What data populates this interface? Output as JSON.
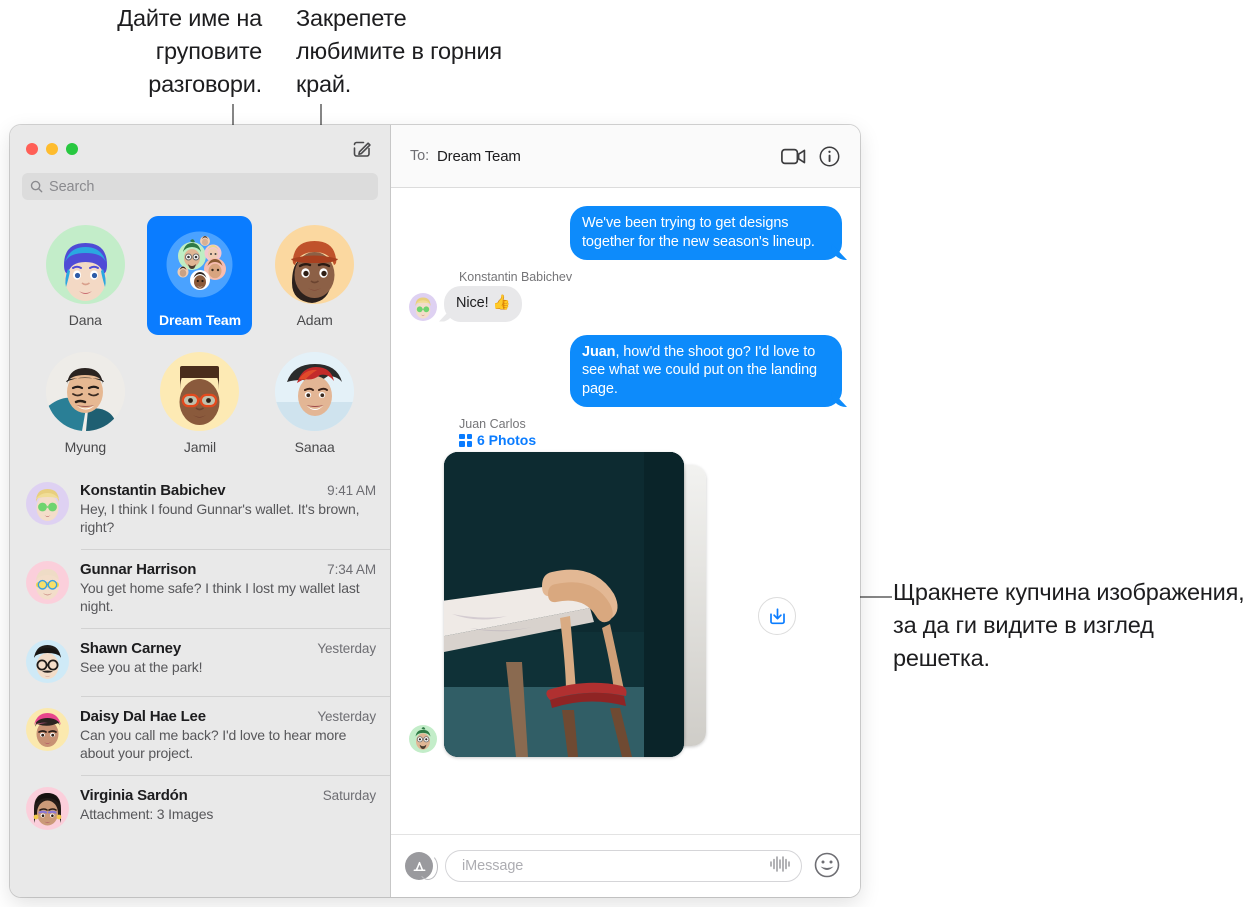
{
  "callouts": {
    "group_name": "Дайте име на груповите разговори.",
    "pin_favorites": "Закрепете любимите в горния край.",
    "photo_stack": "Щракнете купчина изображения, за да ги видите в изглед решетка."
  },
  "window": {
    "traffic_lights": [
      "close-button",
      "minimize-button",
      "zoom-button"
    ],
    "compose_icon": "compose-icon"
  },
  "sidebar": {
    "search": {
      "placeholder": "Search",
      "icon": "search-icon"
    },
    "pinned": [
      {
        "name": "Dana",
        "selected": false,
        "avatar": "memoji-blue-hair"
      },
      {
        "name": "Dream Team",
        "selected": true,
        "avatar": "group-memoji-cluster"
      },
      {
        "name": "Adam",
        "selected": false,
        "avatar": "memoji-orange-cap"
      },
      {
        "name": "Myung",
        "selected": false,
        "avatar": "photo-man-beanie"
      },
      {
        "name": "Jamil",
        "selected": false,
        "avatar": "memoji-orange-glasses"
      },
      {
        "name": "Sanaa",
        "selected": false,
        "avatar": "photo-red-hair"
      }
    ],
    "conversations": [
      {
        "name": "Konstantin Babichev",
        "time": "9:41 AM",
        "preview": "Hey, I think I found Gunnar's wallet. It's brown, right?",
        "avatar": "memoji-blond-green-glasses"
      },
      {
        "name": "Gunnar Harrison",
        "time": "7:34 AM",
        "preview": "You get home safe? I think I lost my wallet last night.",
        "avatar": "memoji-bald-yellow-glasses"
      },
      {
        "name": "Shawn Carney",
        "time": "Yesterday",
        "preview": "See you at the park!",
        "avatar": "memoji-black-hair-glasses"
      },
      {
        "name": "Daisy Dal Hae Lee",
        "time": "Yesterday",
        "preview": "Can you call me back? I'd love to hear more about your project.",
        "avatar": "memoji-pink-cap"
      },
      {
        "name": "Virginia Sardón",
        "time": "Saturday",
        "preview": "Attachment: 3 Images",
        "avatar": "memoji-dark-hair-earrings"
      }
    ]
  },
  "thread": {
    "to_label": "To:",
    "to_value": "Dream Team",
    "facetime_icon": "video-camera-icon",
    "details_icon": "info-circle-icon",
    "messages": [
      {
        "direction": "out",
        "text": "We've been trying to get designs together for the new season's lineup."
      },
      {
        "direction": "in",
        "sender": "Konstantin Babichev",
        "text": "Nice!  👍",
        "avatar": "memoji-blond-green-glasses"
      },
      {
        "direction": "out",
        "bold_prefix": "Juan",
        "text": ", how'd the shoot go? I'd love to see what we could put on the landing page."
      }
    ],
    "attachment": {
      "sender": "Juan Carlos",
      "count_label": "6 Photos",
      "grid_icon": "grid-2x2-icon",
      "download_icon": "download-icon",
      "avatar": "memoji-green-hair-glasses"
    },
    "composer": {
      "appstore_icon": "app-store-icon",
      "placeholder": "iMessage",
      "audio_icon": "audio-waveform-icon",
      "emoji_icon": "smiley-face-icon"
    }
  },
  "colors": {
    "accent_blue": "#0a7cff",
    "bubble_out": "#0d8bfb",
    "bubble_in": "#e8e8ea",
    "sidebar_bg": "#e9e9e9"
  }
}
